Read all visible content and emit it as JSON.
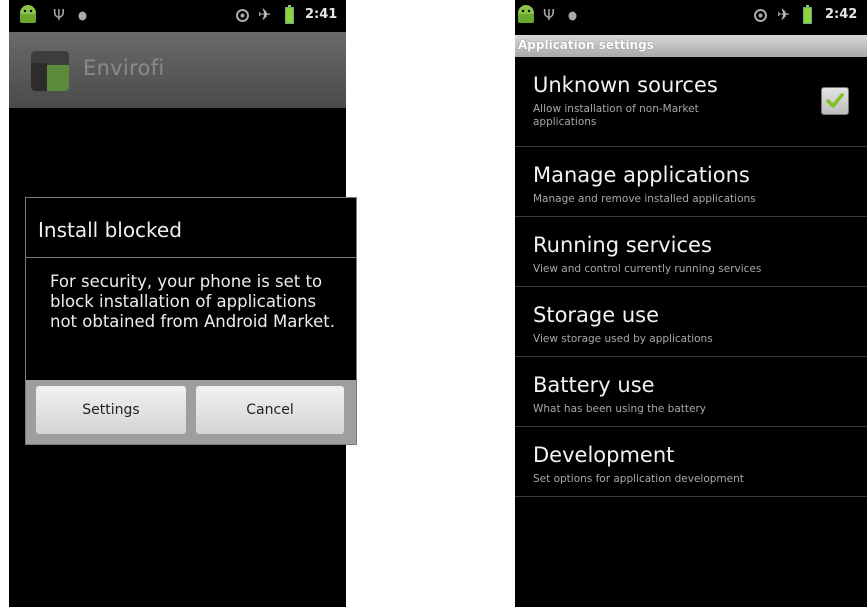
{
  "left_screen": {
    "status_bar": {
      "icons": [
        "android-icon",
        "usb-icon",
        "debug-icon",
        "gps-icon",
        "airplane-icon",
        "battery-icon"
      ],
      "time": "2:41"
    },
    "app_bar": {
      "app_name": "Envirofi",
      "icon": "app-icon"
    },
    "dialog": {
      "title": "Install blocked",
      "message": "For security, your phone is set to block installation of applications not obtained from Android Market.",
      "buttons": {
        "settings_label": "Settings",
        "cancel_label": "Cancel"
      }
    }
  },
  "right_screen": {
    "status_bar": {
      "icons": [
        "android-icon",
        "usb-icon",
        "debug-icon",
        "gps-icon",
        "airplane-icon",
        "battery-icon"
      ],
      "time": "2:42"
    },
    "header": "Application settings",
    "preferences": [
      {
        "title": "Unknown sources",
        "summary": "Allow installation of non-Market applications",
        "checked": true
      },
      {
        "title": "Manage applications",
        "summary": "Manage and remove installed applications"
      },
      {
        "title": "Running services",
        "summary": "View and control currently running services"
      },
      {
        "title": "Storage use",
        "summary": "View storage used by applications"
      },
      {
        "title": "Battery use",
        "summary": "What has been using the battery"
      },
      {
        "title": "Development",
        "summary": "Set options for application development"
      }
    ]
  },
  "colors": {
    "background": "#000000",
    "battery": "#8fd23a",
    "checkmark": "#7dc21e",
    "header_bar": "#b4b4b4",
    "dialog_button_bar": "#9e9e9e"
  }
}
